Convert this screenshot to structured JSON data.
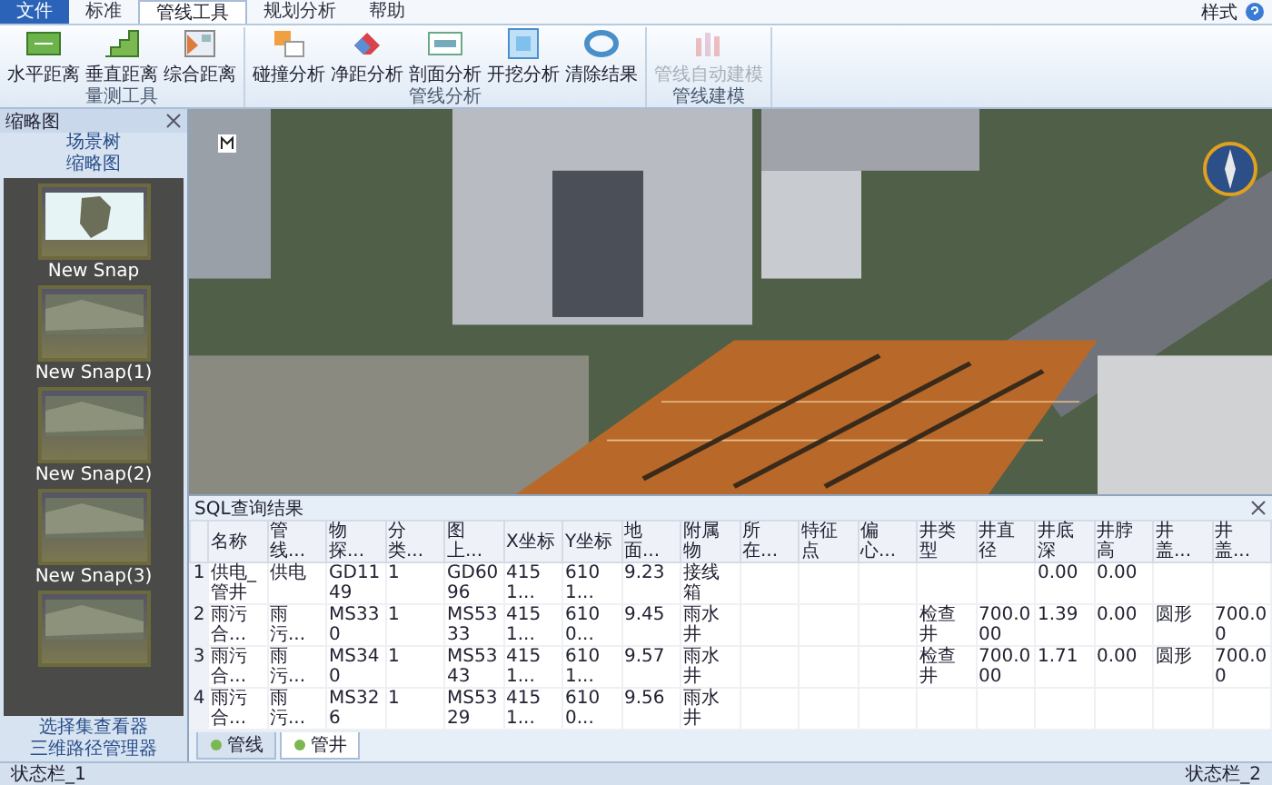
{
  "menu_tabs": [
    {
      "label": "文件",
      "kind": "app",
      "selected": false
    },
    {
      "label": "标准",
      "kind": "tab",
      "selected": false
    },
    {
      "label": "管线工具",
      "kind": "tab",
      "selected": true
    },
    {
      "label": "规划分析",
      "kind": "tab",
      "selected": false
    },
    {
      "label": "帮助",
      "kind": "tab",
      "selected": false
    }
  ],
  "style_menu": {
    "label": "样式"
  },
  "ribbon_groups": [
    {
      "title": "量测工具",
      "buttons": [
        {
          "label": "水平距离",
          "kind": "ruler",
          "disabled": false
        },
        {
          "label": "垂直距离",
          "kind": "steps",
          "disabled": false
        },
        {
          "label": "综合距离",
          "kind": "grid",
          "disabled": false
        }
      ]
    },
    {
      "title": "管线分析",
      "buttons": [
        {
          "label": "碰撞分析",
          "kind": "boxes",
          "disabled": false
        },
        {
          "label": "净距分析",
          "kind": "eraser",
          "disabled": false
        },
        {
          "label": "剖面分析",
          "kind": "window",
          "disabled": false
        },
        {
          "label": "开挖分析",
          "kind": "square",
          "disabled": false
        },
        {
          "label": "清除结果",
          "kind": "cycle",
          "disabled": false
        }
      ]
    },
    {
      "title": "管线建模",
      "buttons": [
        {
          "label": "管线自动建模",
          "kind": "bars",
          "disabled": true
        }
      ]
    }
  ],
  "sidebar": {
    "title": "缩略图",
    "links": [
      "场景树",
      "缩略图"
    ],
    "snaps": [
      {
        "label": "New Snap",
        "kind": "map"
      },
      {
        "label": "New Snap(1)",
        "kind": "aerial"
      },
      {
        "label": "New Snap(2)",
        "kind": "aerial"
      },
      {
        "label": "New Snap(3)",
        "kind": "aerial"
      },
      {
        "kind": "aerial"
      }
    ],
    "footer_links": [
      "选择集查看器",
      "三维路径管理器"
    ]
  },
  "sql_panel": {
    "title": "SQL查询结果",
    "columns": [
      "",
      "名称",
      "管线...",
      "物探...",
      "分类...",
      "图上...",
      "X坐标",
      "Y坐标",
      "地面...",
      "附属物",
      "所在...",
      "特征点",
      "偏心...",
      "井类型",
      "井直径",
      "井底深",
      "井脖高",
      "井盖...",
      "井盖..."
    ],
    "rows": [
      [
        "1",
        "供电_管井",
        "供电",
        "GD1149",
        "1",
        "GD6096",
        "4151...",
        "6101...",
        "9.23",
        "接线箱",
        "",
        "",
        "",
        "",
        "",
        "0.00",
        "0.00",
        "",
        ""
      ],
      [
        "2",
        "雨污合...",
        "雨污...",
        "MS330",
        "1",
        "MS5333",
        "4151...",
        "6100...",
        "9.45",
        "雨水井",
        "",
        "",
        "",
        "检查井",
        "700.000",
        "1.39",
        "0.00",
        "圆形",
        "700.00"
      ],
      [
        "3",
        "雨污合...",
        "雨污...",
        "MS340",
        "1",
        "MS5343",
        "4151...",
        "6101...",
        "9.57",
        "雨水井",
        "",
        "",
        "",
        "检查井",
        "700.000",
        "1.71",
        "0.00",
        "圆形",
        "700.00"
      ],
      [
        "4",
        "雨污合...",
        "雨污...",
        "MS326",
        "1",
        "MS5329",
        "4151...",
        "6100...",
        "9.56",
        "雨水井",
        "",
        "",
        "",
        "",
        "",
        "",
        "",
        "",
        ""
      ]
    ],
    "tabs": [
      {
        "label": "管线",
        "selected": false
      },
      {
        "label": "管井",
        "selected": true
      }
    ]
  },
  "status_bar": {
    "left": "状态栏_1",
    "right": "状态栏_2"
  }
}
